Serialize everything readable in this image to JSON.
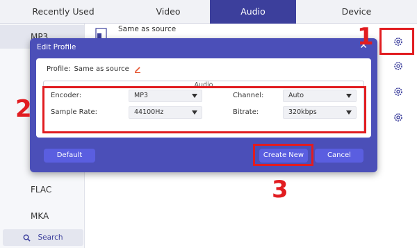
{
  "tabs": [
    {
      "label": "Recently Used"
    },
    {
      "label": "Video"
    },
    {
      "label": "Audio",
      "active": true
    },
    {
      "label": "Device"
    }
  ],
  "sidebar": {
    "items": [
      {
        "label": "MP3",
        "selected": true
      },
      {
        "label": "FLAC"
      },
      {
        "label": "MKA"
      }
    ],
    "search_label": "Search"
  },
  "preset": {
    "title": "Same as source"
  },
  "dialog": {
    "title": "Edit Profile",
    "close_glyph": "✕",
    "profile_label": "Profile:",
    "profile_value": "Same as source",
    "section_label": "Audio",
    "encoder": {
      "label": "Encoder:",
      "value": "MP3"
    },
    "channel": {
      "label": "Channel:",
      "value": "Auto"
    },
    "sample_rate": {
      "label": "Sample Rate:",
      "value": "44100Hz"
    },
    "bitrate": {
      "label": "Bitrate:",
      "value": "320kbps"
    },
    "default_label": "Default",
    "create_label": "Create New",
    "cancel_label": "Cancel"
  },
  "annotations": {
    "one": "1",
    "two": "2",
    "three": "3"
  },
  "colors": {
    "accent": "#3c3f9c",
    "dialog": "#4b4fb8",
    "button": "#5a5ee0",
    "annotation": "#e11c20"
  },
  "icons": {
    "gear": "gear-icon",
    "edit": "pencil-icon",
    "search": "search-icon",
    "file": "audio-file-icon"
  }
}
